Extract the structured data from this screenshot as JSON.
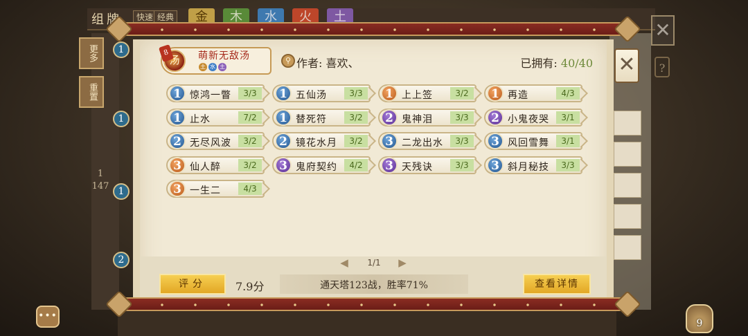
{
  "background": {
    "title": "组牌",
    "tags": [
      "快速",
      "经典"
    ],
    "element_tabs": [
      {
        "label": "金",
        "color": "#d7b34d"
      },
      {
        "label": "木",
        "color": "#5f9a3c"
      },
      {
        "label": "水",
        "color": "#3f86c8"
      },
      {
        "label": "火",
        "color": "#d44a2c"
      },
      {
        "label": "土",
        "color": "#8a5fb8"
      }
    ],
    "side_buttons": [
      "更多",
      "重置"
    ],
    "left_number": "1",
    "left_total": "147"
  },
  "deck": {
    "tag": "8",
    "avatar_glyph": "汤",
    "name": "萌新无敌汤",
    "elements": [
      {
        "label": "土",
        "color": "#c68a2e"
      },
      {
        "label": "水",
        "color": "#3f7fc7"
      },
      {
        "label": "土",
        "color": "#8a5fb8"
      }
    ],
    "author_icon": "⚲",
    "author_label": "作者: 喜欢、",
    "owned_label": "已拥有: ",
    "owned_count": "40/40"
  },
  "cards": [
    {
      "cost": "1",
      "cost_color": "c1",
      "name": "惊鸿一瞥",
      "qty": "3/3"
    },
    {
      "cost": "1",
      "cost_color": "c1",
      "name": "五仙汤",
      "qty": "3/3"
    },
    {
      "cost": "1",
      "cost_color": "c1o",
      "name": "上上签",
      "qty": "3/2"
    },
    {
      "cost": "1",
      "cost_color": "c1o",
      "name": "再造",
      "qty": "4/3"
    },
    {
      "cost": "1",
      "cost_color": "c1",
      "name": "止水",
      "qty": "7/2"
    },
    {
      "cost": "1",
      "cost_color": "c1",
      "name": "替死符",
      "qty": "3/2"
    },
    {
      "cost": "2",
      "cost_color": "c2p",
      "name": "鬼神泪",
      "qty": "3/3"
    },
    {
      "cost": "2",
      "cost_color": "c2p",
      "name": "小鬼夜哭",
      "qty": "3/1"
    },
    {
      "cost": "2",
      "cost_color": "c2b",
      "name": "无尽风波",
      "qty": "3/2"
    },
    {
      "cost": "2",
      "cost_color": "c2b",
      "name": "镜花水月",
      "qty": "3/2"
    },
    {
      "cost": "3",
      "cost_color": "c3b",
      "name": "二龙出水",
      "qty": "3/3"
    },
    {
      "cost": "3",
      "cost_color": "c3b",
      "name": "风回雪舞",
      "qty": "3/1"
    },
    {
      "cost": "3",
      "cost_color": "c3o",
      "name": "仙人醉",
      "qty": "3/2"
    },
    {
      "cost": "3",
      "cost_color": "c3p",
      "name": "鬼府契约",
      "qty": "4/2"
    },
    {
      "cost": "3",
      "cost_color": "c3p",
      "name": "天残诀",
      "qty": "3/3"
    },
    {
      "cost": "3",
      "cost_color": "c3b",
      "name": "斜月秘技",
      "qty": "3/3"
    },
    {
      "cost": "3",
      "cost_color": "c3o",
      "name": "一生二",
      "qty": "4/3"
    }
  ],
  "pager": {
    "text": "1/1",
    "prev_icon": "◀",
    "next_icon": "▶"
  },
  "footer": {
    "rating_label": "评分",
    "rating_value": "7.9分",
    "record": "通天塔123战，胜率71%",
    "detail_label": "查看详情"
  },
  "close_icon": "✕",
  "help_icon": "?",
  "chat_icon": "•••",
  "pouch_count": "9"
}
